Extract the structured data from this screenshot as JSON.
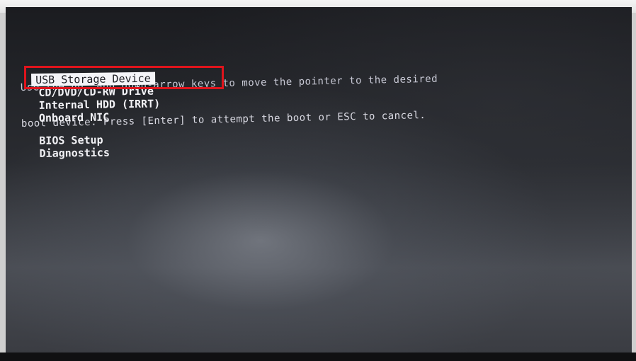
{
  "instruction": {
    "line1": "Use the up  and down-arrow keys to move the pointer to the desired",
    "line2": "boot device. Press [Enter] to attempt the boot or ESC to cancel."
  },
  "boot_menu": {
    "items": [
      {
        "label": "USB Storage Device"
      },
      {
        "label": "CD/DVD/CD-RW Drive"
      },
      {
        "label": "Internal HDD (IRRT)"
      },
      {
        "label": "Onboard NIC"
      }
    ],
    "other_items": [
      {
        "label": "BIOS Setup"
      },
      {
        "label": "Diagnostics"
      }
    ]
  },
  "colors": {
    "highlight_box": "#e0141c",
    "selection_bg": "#f4f4f8",
    "text": "#f2f2f6"
  }
}
